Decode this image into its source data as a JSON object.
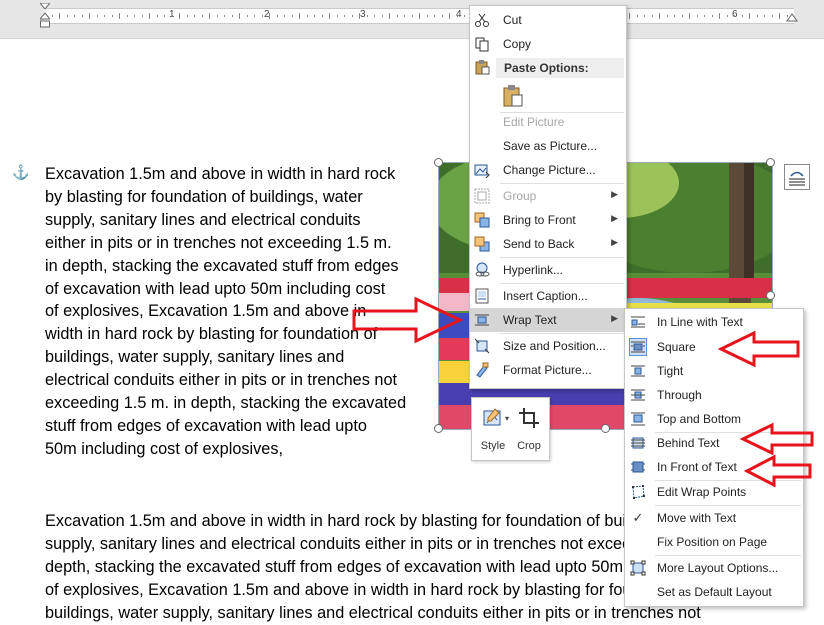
{
  "ruler": {
    "numbers": [
      "1",
      "2",
      "3",
      "4",
      "5",
      "6"
    ]
  },
  "document": {
    "paragraph1_lines": [
      "Excavation 1.5m and above in width in hard rock",
      "by blasting for foundation of buildings, water",
      "supply, sanitary lines and electrical conduits",
      "either in pits or in trenches not exceeding 1.5 m.",
      "in depth, stacking the excavated stuff from edges",
      "of excavation with lead upto  50m including cost",
      "of explosives, Excavation 1.5m and above in",
      "width in hard rock by blasting for foundation of",
      "buildings, water supply, sanitary lines and",
      "electrical conduits either in pits or in trenches not",
      "exceeding 1.5 m. in depth, stacking the excavated",
      "stuff from edges of excavation with lead upto",
      "50m including cost of explosives,"
    ],
    "paragraph2_lines": [
      "Excavation 1.5m and above in width in hard rock by blasting for foundation of buildings, water",
      "supply, sanitary lines and electrical conduits either in pits or in trenches not exceeding 1.5 m. in",
      "depth, stacking the excavated stuff from edges of excavation with lead upto  50m including cost",
      "of explosives, Excavation 1.5m and above in width in hard rock by blasting for foundation of",
      "buildings, water supply, sanitary lines and electrical conduits either in pits or in trenches not"
    ]
  },
  "context_menu": {
    "cut": "Cut",
    "copy": "Copy",
    "paste_options": "Paste Options:",
    "edit_picture": "Edit Picture",
    "save_as_picture": "Save as Picture...",
    "change_picture": "Change Picture...",
    "group": "Group",
    "bring_to_front": "Bring to Front",
    "send_to_back": "Send to Back",
    "hyperlink": "Hyperlink...",
    "insert_caption": "Insert Caption...",
    "wrap_text": "Wrap Text",
    "size_and_position": "Size and Position...",
    "format_picture": "Format Picture..."
  },
  "mini_toolbar": {
    "style": "Style",
    "crop": "Crop"
  },
  "wrap_submenu": {
    "items": [
      "In Line with Text",
      "Square",
      "Tight",
      "Through",
      "Top and Bottom",
      "Behind Text",
      "In Front of Text",
      "Edit Wrap Points",
      "Move with Text",
      "Fix Position on Page",
      "More Layout Options...",
      "Set as Default Layout"
    ],
    "selected": "Square",
    "checked": "Move with Text"
  },
  "colors": {
    "annotation_arrow": "#e8141c",
    "menu_highlight": "#d5d5d5",
    "anchor": "#2b6cb8"
  }
}
